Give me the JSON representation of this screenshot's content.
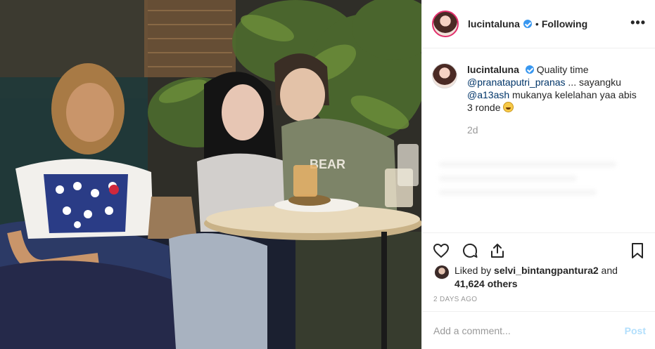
{
  "header": {
    "username": "lucintaluna",
    "separator": "•",
    "follow_status": "Following",
    "more": "•••"
  },
  "caption": {
    "username": "lucintaluna",
    "text_1": "Quality time",
    "mention_1": "@pranataputri_pranas",
    "text_2": "... sayangku",
    "mention_2": "@a13ash",
    "text_3": "mukanya kelelahan yaa abis 3 ronde",
    "emoji": "tired-face-emoji",
    "relative_time": "2d"
  },
  "actions": {
    "like": "heart-icon",
    "comment": "comment-icon",
    "share": "share-icon",
    "save": "bookmark-icon"
  },
  "likes": {
    "prefix": "Liked by",
    "liker": "selvi_bintangpantura2",
    "joiner": "and",
    "count": "41,624 others"
  },
  "posted": "2 DAYS AGO",
  "comment_box": {
    "placeholder": "Add a comment...",
    "post_label": "Post"
  },
  "colors": {
    "verified": "#3897f0",
    "mention": "#003569",
    "muted": "#999999",
    "post_disabled": "#b2dffc"
  }
}
